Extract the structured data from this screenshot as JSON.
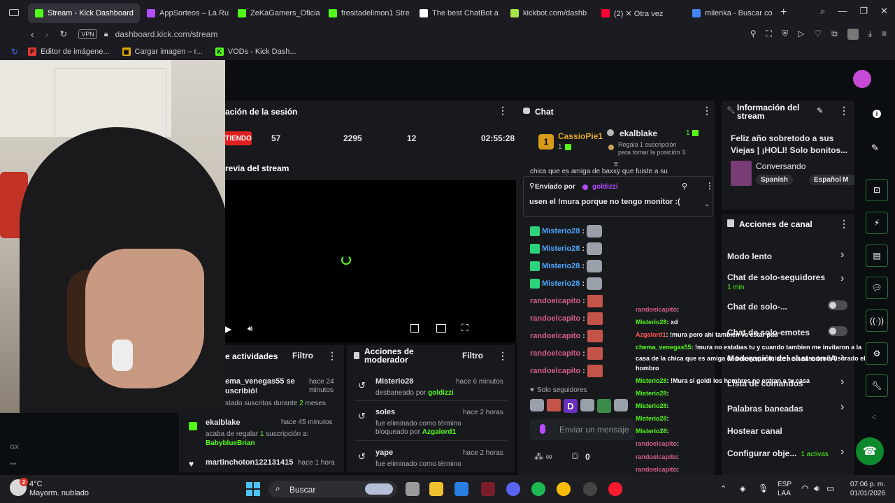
{
  "browser": {
    "tabs": [
      {
        "label": "Stream - Kick Dashboard",
        "color": "#53fc18",
        "active": true
      },
      {
        "label": "AppSorteos – La Ru",
        "color": "#b44cff"
      },
      {
        "label": "ZeKaGamers_Oficia",
        "color": "#53fc18"
      },
      {
        "label": "fresitadelimon1 Stre",
        "color": "#53fc18"
      },
      {
        "label": "The best ChatBot a",
        "color": "#ffffff"
      },
      {
        "label": "kickbot.com/dashb",
        "color": "#a7e34a"
      },
      {
        "label": "(2) ✕ Otra vez",
        "color": "#ff0033"
      },
      {
        "label": "milenka - Buscar co",
        "color": "#4285f4"
      }
    ],
    "new_tab": "+",
    "vpn": "VPN",
    "url": "dashboard.kick.com/stream",
    "bookmarks": [
      {
        "label": "Editor de imágene...",
        "color": "#e53935",
        "glyph": "P"
      },
      {
        "label": "Cargar imagen – r...",
        "color": "#e0b000",
        "glyph": "▣"
      },
      {
        "label": "VODs - Kick Dash...",
        "color": "#53fc18",
        "glyph": "K"
      }
    ]
  },
  "session": {
    "title": "ación de la sesión",
    "status": "TIENDO",
    "stats": [
      "57",
      "2295",
      "12",
      "02:55:28"
    ]
  },
  "preview": {
    "title": "revia del stream"
  },
  "activity": {
    "title": "e actividades",
    "filter": "Filtro",
    "items": [
      {
        "user": "ema_venegas55 se",
        "line2": "uscribió!",
        "detail": "stado suscritos durante",
        "count": "2",
        "unit": "meses",
        "time": "hace 24",
        "time2": "minutos"
      },
      {
        "user": "ekalblake",
        "detail": "acaba de regalar",
        "count": "1",
        "detail2": "suscripción a:",
        "target": "BabyblueBrian",
        "time": "hace 45 minutos"
      },
      {
        "user": "martinchoton122131415",
        "time": "hace 1 hora"
      }
    ]
  },
  "moderator": {
    "title": "Acciones de moderador",
    "filter": "Filtro",
    "items": [
      {
        "user": "Misterio28",
        "detail": "desbaneado por",
        "by": "goldizzi",
        "time": "hace 6 minutos"
      },
      {
        "user": "soles",
        "detail": "fue eliminado como término bloqueado por",
        "by": "Azgalord1",
        "time": "hace 2 horas"
      },
      {
        "user": "yape",
        "detail": "fue eliminado como término",
        "time": "hace 2 horas"
      }
    ]
  },
  "chat": {
    "title": "Chat",
    "top_gifter": {
      "rank": "1",
      "name": "CassioPie1",
      "count": "1"
    },
    "gifter2": {
      "name": "ekalblake",
      "count": "1",
      "note": "Regala 1 suscripción",
      "note2": "para tomar la posición 3"
    },
    "scroll_text": "chica que es amiga de baxxy que fuiste a su",
    "pinned": {
      "label": "Enviado por",
      "user": "goldizzi",
      "message": "usen el !mura porque no tengo monitor :("
    },
    "messages": [
      {
        "user": "Misterio28"
      },
      {
        "user": "Misterio28"
      },
      {
        "user": "Misterio28"
      },
      {
        "user": "Misterio28"
      },
      {
        "user": "randoelcapito"
      },
      {
        "user": "randoelcapito"
      },
      {
        "user": "randoelcapito"
      },
      {
        "user": "randoelcapito"
      },
      {
        "user": "randoelcapito"
      }
    ],
    "followers_only": "Solo seguidores",
    "input_placeholder": "Enviar un mensaje",
    "count": "0"
  },
  "overlay_chat": [
    {
      "user": "randoelcapito",
      "text": ":",
      "color": "#d45c8a"
    },
    {
      "user": "Misterio28",
      "text": ": xd",
      "color": "#53fc18"
    },
    {
      "user": "Azgalord1",
      "text": ": !mura pero ahi tambien va estar pau",
      "color": "#ff5555"
    },
    {
      "user": "chema_venegas55",
      "text": ": !mura no estabas tu y cuando tambien me invitaron a la",
      "color": "#53fc18"
    },
    {
      "user": "",
      "text": "casa de la chica que es amiga de baxxy que fuiste a su casa tenia fisurado el",
      "color": "#ffffff"
    },
    {
      "user": "",
      "text": "hombro",
      "color": "#ffffff"
    },
    {
      "user": "Misterio28",
      "text": ": !Mura si goldi los hombres no entran a tu casa",
      "color": "#53fc18"
    },
    {
      "user": "Misterio28",
      "text": ":",
      "color": "#53fc18"
    },
    {
      "user": "Misterio28",
      "text": ":",
      "color": "#53fc18"
    },
    {
      "user": "Misterio28",
      "text": ":",
      "color": "#53fc18"
    },
    {
      "user": "Misterio28",
      "text": ":",
      "color": "#53fc18"
    },
    {
      "user": "randoelcapito",
      "text": ":",
      "color": "#d45c8a"
    },
    {
      "user": "randoelcapito",
      "text": ":",
      "color": "#d45c8a"
    },
    {
      "user": "randoelcapito",
      "text": ":",
      "color": "#d45c8a"
    },
    {
      "user": "randoelcapito",
      "text": ":",
      "color": "#d45c8a"
    },
    {
      "user": "randoelcapito",
      "text": ":",
      "color": "#d45c8a"
    }
  ],
  "stream_info": {
    "title": "Información del stream",
    "stream_title": "Feliz año sobretodo a sus Viejas | ¡HOLI! Solo bonitos...",
    "category": "Conversando",
    "tags": [
      "Spanish",
      "Español",
      "M"
    ]
  },
  "channel_actions": {
    "title": "Acciones de canal",
    "items": [
      {
        "label": "Modo lento"
      },
      {
        "label": "Chat de solo-seguidores",
        "sub": "1 min"
      },
      {
        "label": "Chat de solo-..."
      },
      {
        "label": "Chat de solo-emotes"
      },
      {
        "label": "Moderación del chat con IA"
      },
      {
        "label": "Lista de comandos"
      },
      {
        "label": "Palabras baneadas"
      },
      {
        "label": "Hostear canal"
      },
      {
        "label": "Configurar obje...",
        "sub": "1 activas"
      }
    ]
  },
  "taskbar": {
    "temp": "4°C",
    "weather": "Mayorm. nublado",
    "search": "Buscar",
    "lang": "ESP",
    "lang2": "LAA",
    "time": "07:06 p. m.",
    "date": "01/01/2026"
  }
}
